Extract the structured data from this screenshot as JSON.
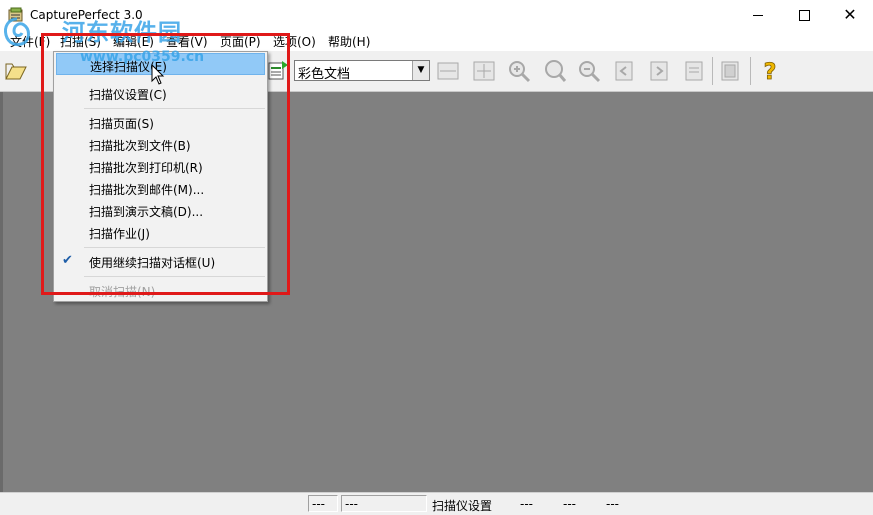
{
  "window": {
    "title": "CapturePerfect 3.0",
    "minimize_glyph": "",
    "close_glyph": "✕"
  },
  "watermark": {
    "text": "河东软件园",
    "url": "www.pc0359.cn"
  },
  "menubar": {
    "items": [
      "文件(F)",
      "扫描(S)",
      "编辑(E)",
      "查看(V)",
      "页面(P)",
      "选项(O)",
      "帮助(H)"
    ]
  },
  "toolbar": {
    "combo_value": "彩色文档",
    "icons": [
      "open-icon",
      "scan-page-icon",
      "fit-width-icon",
      "fit-page-icon",
      "zoom-in-icon",
      "zoom-100-icon",
      "zoom-out-icon",
      "prev-page-icon",
      "next-page-icon",
      "rotate-icon",
      "page-icon",
      "help-icon"
    ]
  },
  "scan_menu": {
    "items": [
      {
        "label": "选择扫描仪(E)",
        "highlight": true
      },
      {
        "label": "扫描仪设置(C)"
      },
      {
        "label": "扫描页面(S)"
      },
      {
        "label": "扫描批次到文件(B)"
      },
      {
        "label": "扫描批次到打印机(R)"
      },
      {
        "label": "扫描批次到邮件(M)..."
      },
      {
        "label": "扫描到演示文稿(D)..."
      },
      {
        "label": "扫描作业(J)"
      },
      {
        "label": "使用继续扫描对话框(U)",
        "checked": true
      },
      {
        "label": "取消扫描(N)",
        "disabled": true
      }
    ]
  },
  "statusbar": {
    "panel1": "---",
    "panel2": "---",
    "status_text": "扫描仪设置",
    "field1": "---",
    "field2": "---",
    "field3": "---"
  },
  "colors": {
    "workspace": "#808080",
    "highlight": "#91c9f7",
    "annotation": "#e01919",
    "watermark": "#3aa4e8"
  }
}
